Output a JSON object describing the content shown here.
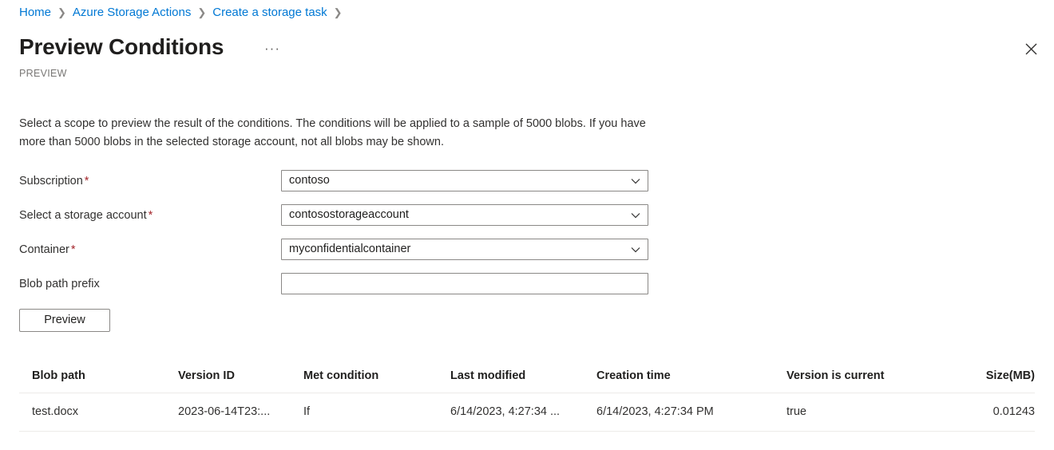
{
  "breadcrumb": {
    "separator": "❯",
    "items": [
      {
        "label": "Home"
      },
      {
        "label": "Azure Storage Actions"
      },
      {
        "label": "Create a storage task"
      }
    ]
  },
  "header": {
    "title": "Preview Conditions",
    "more_menu": "···",
    "preview_tag": "PREVIEW",
    "close_icon": "close-icon"
  },
  "description": "Select a scope to preview the result of the conditions. The conditions will be applied to a sample of 5000 blobs. If you have more than 5000 blobs in the selected storage account, not all blobs may be shown.",
  "form": {
    "required_marker": "*",
    "fields": [
      {
        "label": "Subscription",
        "required": true,
        "type": "dropdown",
        "value": "contoso",
        "placeholder": ""
      },
      {
        "label": "Select a storage account",
        "required": true,
        "type": "dropdown",
        "value": "contosostorageaccount",
        "placeholder": ""
      },
      {
        "label": "Container",
        "required": true,
        "type": "dropdown",
        "value": "myconfidentialcontainer",
        "placeholder": ""
      },
      {
        "label": "Blob path prefix",
        "required": false,
        "type": "text",
        "value": "",
        "placeholder": ""
      }
    ],
    "preview_button": "Preview"
  },
  "results": {
    "columns": [
      "Blob path",
      "Version ID",
      "Met condition",
      "Last modified",
      "Creation time",
      "Version is current",
      "Size(MB)"
    ],
    "rows": [
      {
        "blob_path": "test.docx",
        "version_id": "2023-06-14T23:...",
        "met_condition": "If",
        "last_modified": "6/14/2023, 4:27:34 ...",
        "creation_time": "6/14/2023, 4:27:34 PM",
        "version_is_current": "true",
        "size_mb": "0.01243"
      }
    ]
  },
  "colors": {
    "link": "#0078d4",
    "required": "#a4262c",
    "text": "#323130",
    "muted": "#797775",
    "border": "#8a8886",
    "rule": "#edebe9"
  }
}
